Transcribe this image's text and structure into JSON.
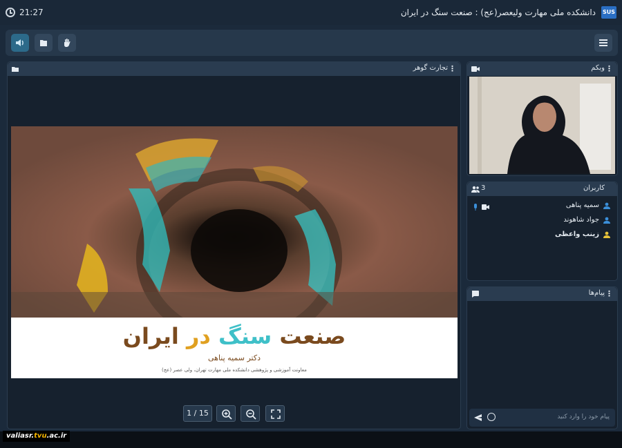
{
  "titlebar": {
    "time": "21:27",
    "room_title": "دانشکده ملی مهارت ولیعصر(عج) : صنعت سنگ در ایران",
    "logo_text": "SUS"
  },
  "toolbar": {
    "icons": [
      "speaker-icon",
      "share-icon",
      "raise-hand-icon",
      "menu-icon"
    ]
  },
  "presentation": {
    "panel_title": "تجارت گوهر",
    "slide": {
      "heading_words": [
        "صنعت",
        "سنگ",
        "در",
        "ایران"
      ],
      "author": "دکتر سمیه پناهی",
      "affiliation": "معاونت آموزشی و پژوهشی دانشکده ملی مهارت تهران، ولی عصر (عج)"
    },
    "pager": "1 / 15"
  },
  "webcam": {
    "panel_title": "وبکم"
  },
  "users": {
    "panel_title": "کاربران",
    "count": "3",
    "list": [
      {
        "name": "سمیه پناهی",
        "icon_color": "#3b8fd9",
        "bold": false
      },
      {
        "name": "جواد شاهوند",
        "icon_color": "#3b8fd9",
        "bold": false
      },
      {
        "name": "زینب واعظی",
        "icon_color": "#e6c23a",
        "bold": true
      }
    ]
  },
  "messages": {
    "panel_title": "پیام‌ها",
    "input_placeholder": "پیام خود را وارد کنید"
  },
  "footer": {
    "watermark_prefix": "valiasr.",
    "watermark_highlight": "tvu",
    "watermark_suffix": ".ac.ir"
  },
  "colors": {
    "background": "#1b2a3b",
    "panel": "#16212e",
    "accent": "#2c6a8a"
  }
}
